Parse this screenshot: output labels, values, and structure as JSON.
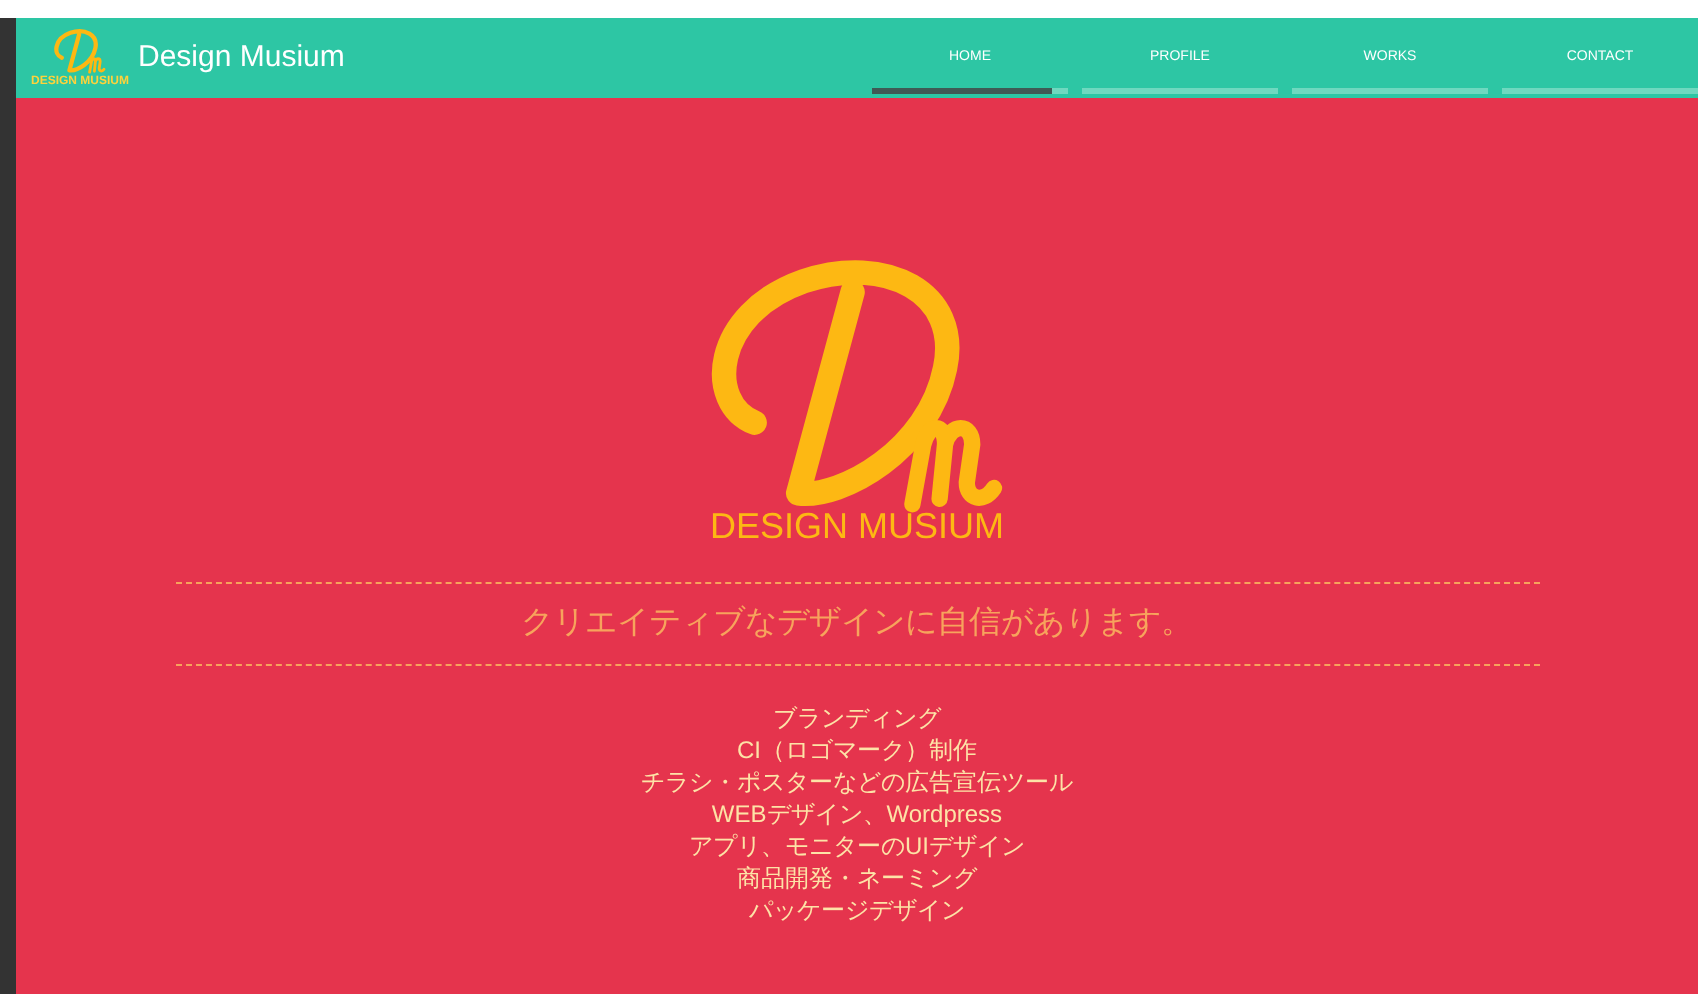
{
  "header": {
    "logo_caption": "DESIGN MUSIUM",
    "site_title": "Design Musium"
  },
  "nav": [
    {
      "label": "HOME",
      "selected": true
    },
    {
      "label": "PROFILE",
      "selected": false
    },
    {
      "label": "WORKS",
      "selected": false
    },
    {
      "label": "CONTACT",
      "selected": false
    }
  ],
  "hero": {
    "logo_caption": "DESIGN MUSIUM",
    "tagline": "クリエイティブなデザインに自信があります。",
    "services": [
      "ブランディング",
      "CI（ロゴマーク）制作",
      "チラシ・ポスターなどの広告宣伝ツール",
      "WEBデザイン、Wordpress",
      "アプリ、モニターのUIデザイン",
      "商品開発・ネーミング",
      "パッケージデザイン"
    ]
  }
}
